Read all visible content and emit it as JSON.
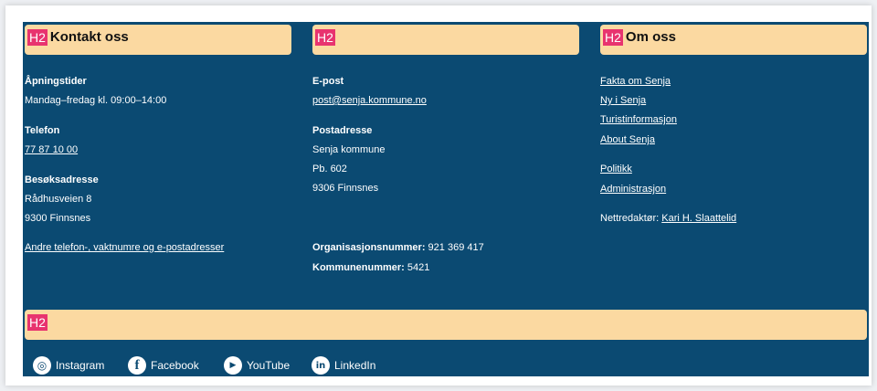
{
  "columns": [
    {
      "heading_tag": "H2",
      "heading": "Kontakt oss",
      "opening_label": "Åpningstider",
      "opening_value": "Mandag–fredag kl. 09:00–14:00",
      "phone_label": "Telefon",
      "phone_value": "77 87 10 00",
      "visit_label": "Besøksadresse",
      "visit_line1": "Rådhusveien 8",
      "visit_line2": "9300 Finnsnes",
      "more_link": "Andre telefon-, vaktnumre og e-postadresser"
    },
    {
      "heading_tag": "H2",
      "heading": "",
      "email_label": "E-post",
      "email_value": "post@senja.kommune.no",
      "postal_label": "Postadresse",
      "postal_line1": "Senja kommune",
      "postal_line2": "Pb. 602",
      "postal_line3": "9306 Finnsnes",
      "org_label": "Organisasjonsnummer:",
      "org_value": "921 369 417",
      "muni_label": "Kommunenummer:",
      "muni_value": "5421"
    },
    {
      "heading_tag": "H2",
      "heading": "Om oss",
      "links": [
        "Fakta om Senja",
        "Ny i Senja",
        "Turistinformasjon",
        "About Senja",
        "Politikk",
        "Administrasjon"
      ],
      "editor_label": "Nettredaktør:",
      "editor_name": "Kari H. Slaattelid"
    }
  ],
  "bottom_heading_tag": "H2",
  "social": [
    {
      "label": "Instagram",
      "icon": "instagram-icon"
    },
    {
      "label": "Facebook",
      "icon": "facebook-icon"
    },
    {
      "label": "YouTube",
      "icon": "youtube-icon"
    },
    {
      "label": "LinkedIn",
      "icon": "linkedin-icon"
    }
  ],
  "colors": {
    "footer_bg": "#0b4a72",
    "heading_bg": "#fbd9a1",
    "h2_tag": "#e8336f"
  }
}
